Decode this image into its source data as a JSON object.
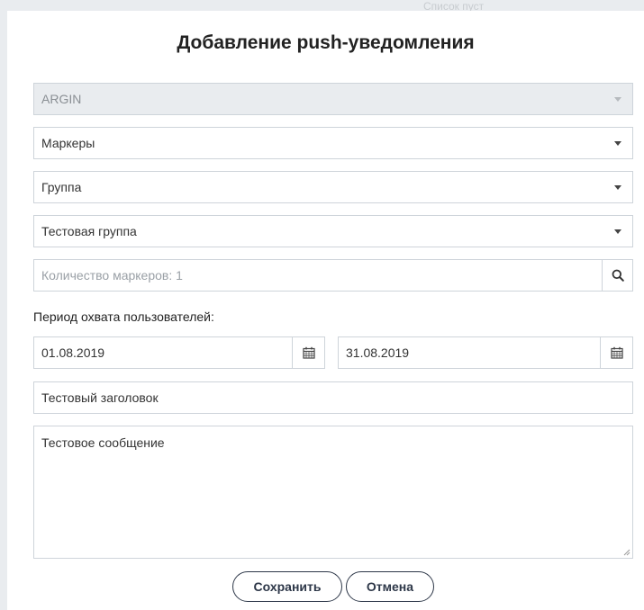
{
  "background": {
    "partial_text": "Список пуст"
  },
  "modal": {
    "title": "Добавление push-уведомления",
    "selects": {
      "organization": {
        "value": "ARGIN",
        "disabled": true
      },
      "target_type": {
        "value": "Маркеры"
      },
      "selection_type": {
        "value": "Группа"
      },
      "group": {
        "value": "Тестовая группа"
      }
    },
    "markers_search": {
      "placeholder": "Количество маркеров: 1"
    },
    "period": {
      "label": "Период охвата пользователей:",
      "start_date": "01.08.2019",
      "end_date": "31.08.2019"
    },
    "header_input": {
      "value": "Тестовый заголовок"
    },
    "message_textarea": {
      "value": "Тестовое сообщение"
    },
    "buttons": {
      "save_label": "Сохранить",
      "cancel_label": "Отмена"
    }
  },
  "icons": {
    "dropdown": "chevron-down-icon",
    "search": "search-icon",
    "calendar": "calendar-icon",
    "resize": "resize-handle-icon"
  }
}
